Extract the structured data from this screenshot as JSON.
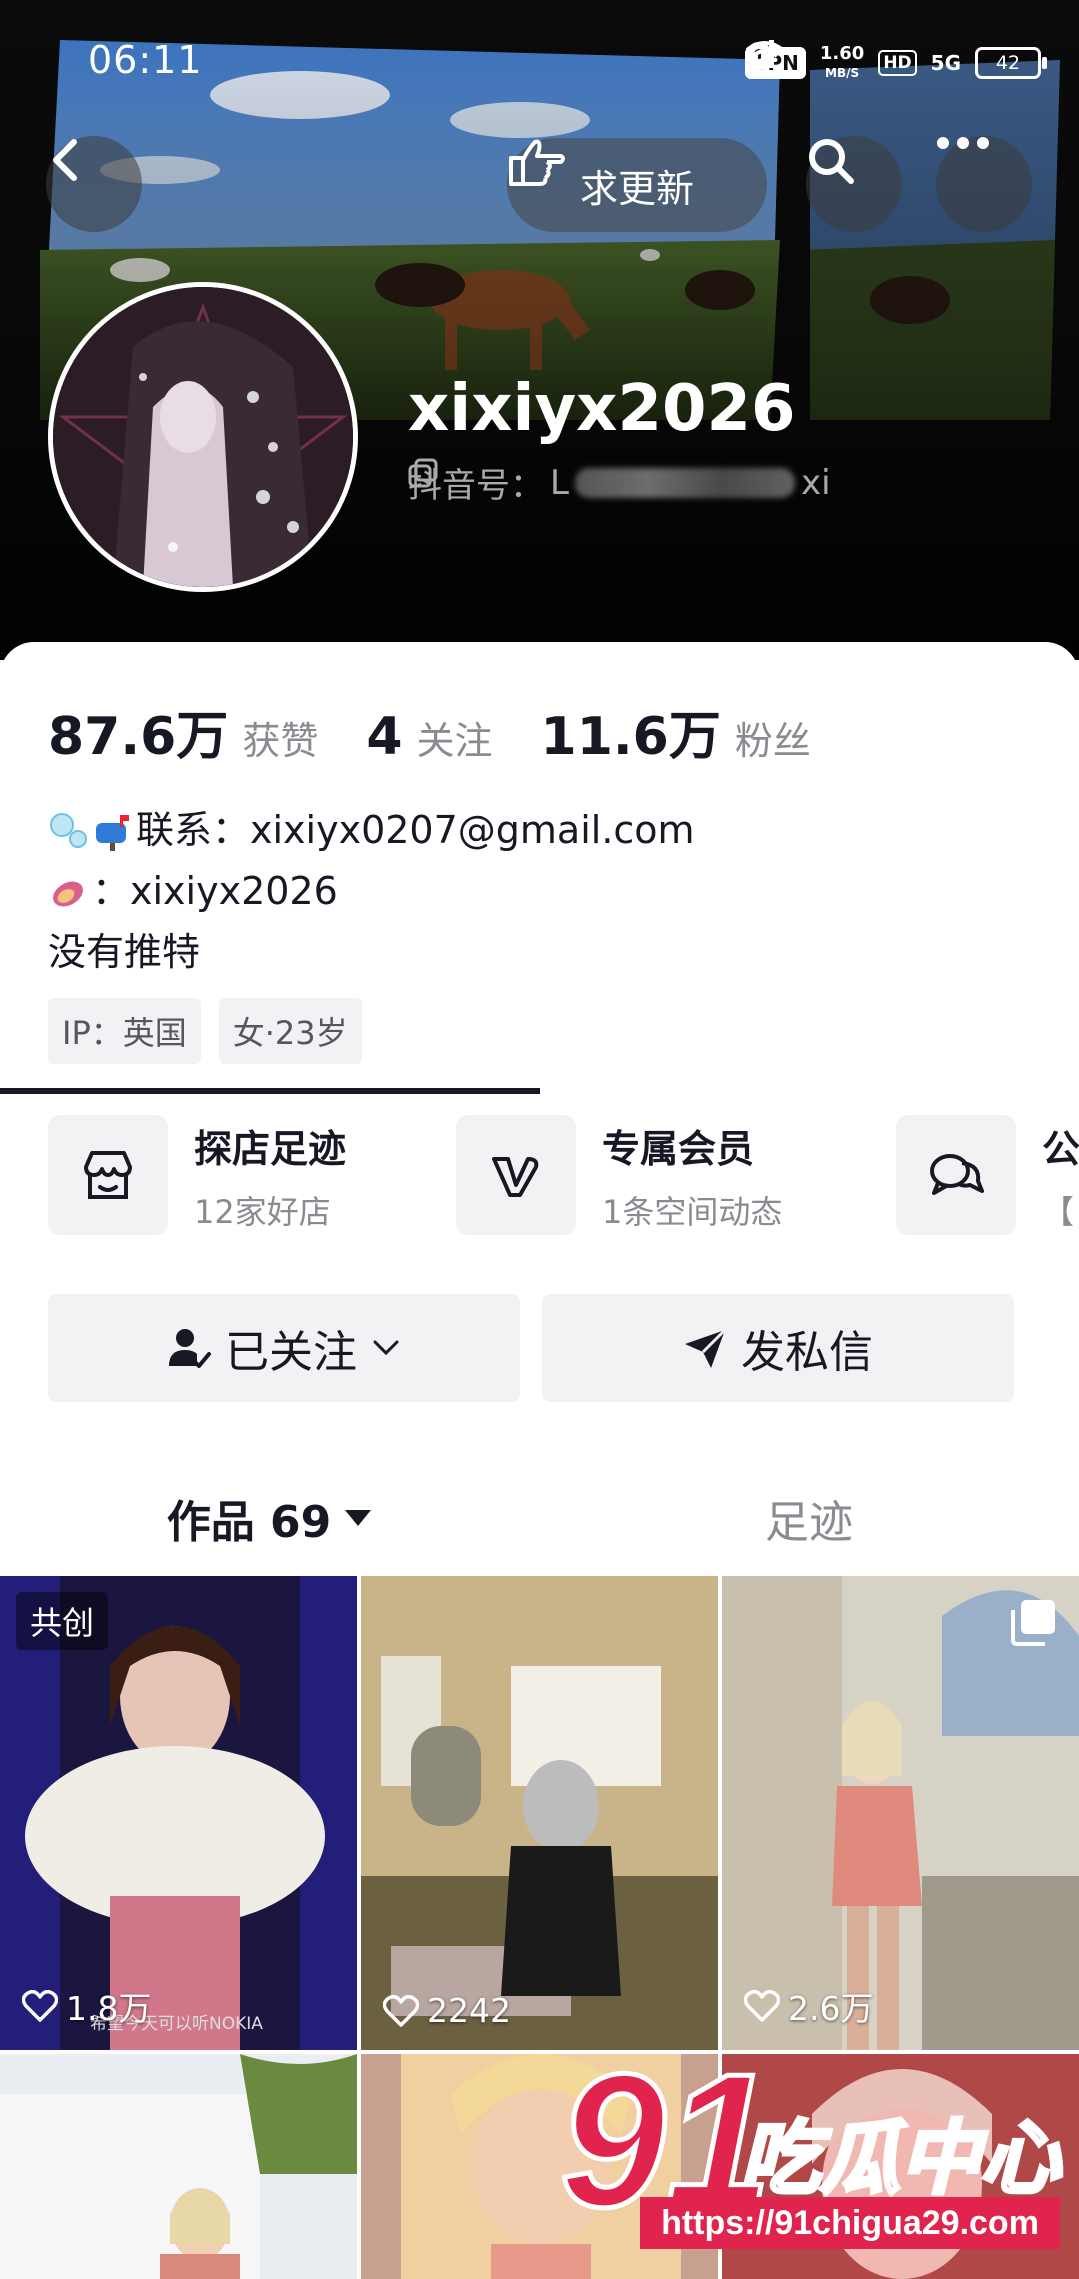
{
  "status_bar": {
    "time": "06:11",
    "vpn": "VPN",
    "speed_value": "1.60",
    "speed_unit": "MB/S",
    "hd": "HD",
    "network": "5G",
    "battery": "42"
  },
  "header": {
    "request_update_label": "求更新",
    "username": "xixiyx2026",
    "douyin_id_label": "抖音号：",
    "douyin_id_value": "L",
    "douyin_id_tail": "xi"
  },
  "stats": [
    {
      "value": "87.6万",
      "label": "获赞"
    },
    {
      "value": "4",
      "label": "关注"
    },
    {
      "value": "11.6万",
      "label": "粉丝"
    }
  ],
  "bio": {
    "line1": "联系：xixiyx0207@gmail.com",
    "line2": "：xixiyx2026",
    "line3": "没有推特"
  },
  "tags": [
    "IP：英国",
    "女·23岁"
  ],
  "features": [
    {
      "title": "探店足迹",
      "subtitle": "12家好店",
      "icon": "shop-icon"
    },
    {
      "title": "专属会员",
      "subtitle": "1条空间动态",
      "icon": "vip-v-icon"
    },
    {
      "title": "公",
      "subtitle": "【",
      "icon": "chat-bubble-icon"
    }
  ],
  "actions": {
    "followed_label": "已关注",
    "message_label": "发私信"
  },
  "tabs": {
    "works_label": "作品 69",
    "footprint_label": "足迹"
  },
  "grid": [
    {
      "likes": "1.8万",
      "badge": "共创",
      "caption": "希望今天可以听NOKIA"
    },
    {
      "likes": "2242"
    },
    {
      "likes": "2.6万",
      "multi": true
    },
    {
      "likes": ""
    },
    {
      "likes": ""
    },
    {
      "likes": ""
    }
  ],
  "watermark": {
    "big": "91",
    "text": "吃瓜中心",
    "url": "https://91chigua29.com"
  },
  "colors": {
    "accent_red": "#e0244d",
    "text_primary": "#161823",
    "text_secondary": "#8a8b91",
    "button_bg": "#f2f2f4"
  }
}
